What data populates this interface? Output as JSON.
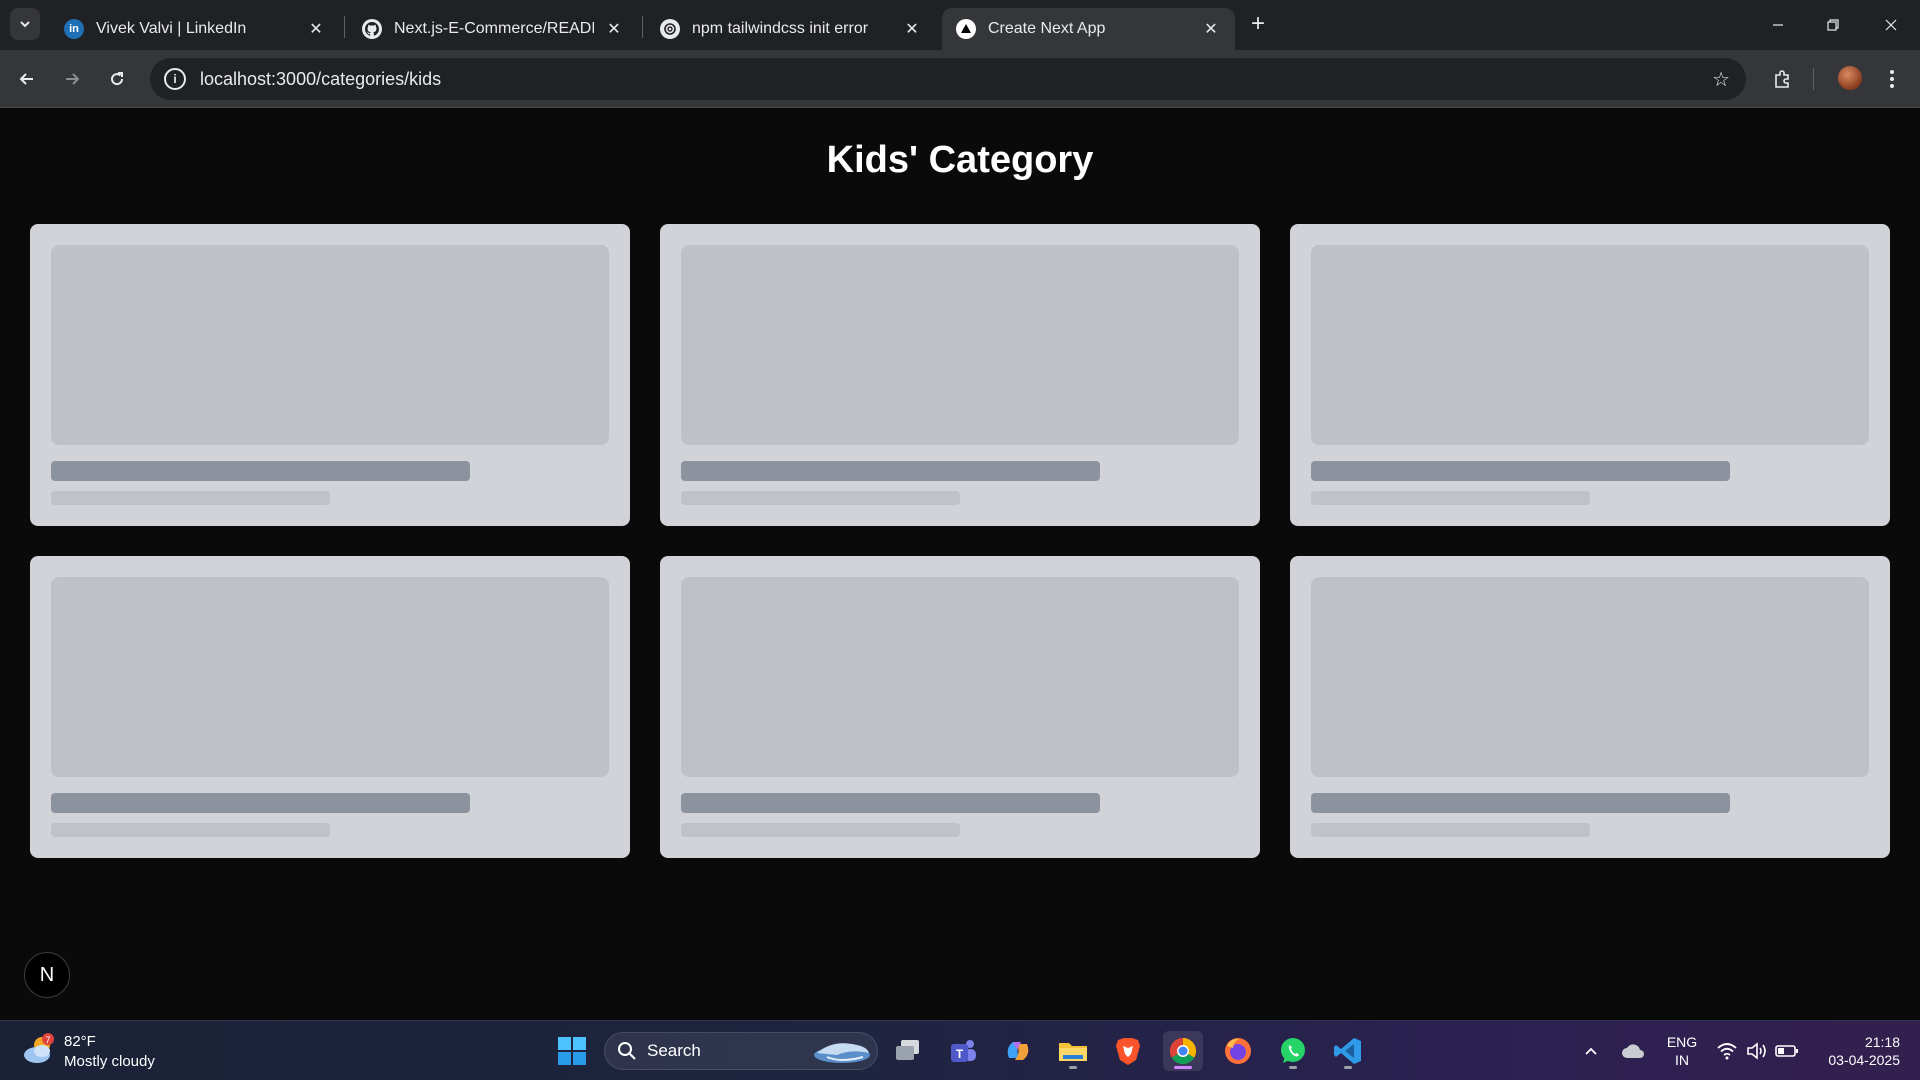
{
  "browser": {
    "tabs": [
      {
        "title": "Vivek Valvi | LinkedIn",
        "icon": "linkedin-icon",
        "active": false
      },
      {
        "title": "Next.js-E-Commerce/README.md",
        "icon": "github-icon",
        "active": false
      },
      {
        "title": "npm tailwindcss init error",
        "icon": "chatgpt-icon",
        "active": false
      },
      {
        "title": "Create Next App",
        "icon": "nextjs-icon",
        "active": true
      }
    ],
    "url": "localhost:3000/categories/kids"
  },
  "page": {
    "title": "Kids' Category",
    "cards_count_label": "",
    "next_badge": "N"
  },
  "taskbar": {
    "weather": {
      "temp": "82°F",
      "desc": "Mostly cloudy",
      "badge": "7"
    },
    "search_label": "Search",
    "lang_line1": "ENG",
    "lang_line2": "IN",
    "time": "21:18",
    "date": "03-04-2025"
  },
  "colors": {
    "page_bg": "#0a0a0a",
    "card_bg": "#d1d3d8",
    "skeleton_image": "#bfc1c8",
    "skeleton_title": "#8c939e",
    "skeleton_subtitle": "#c0c2c9"
  }
}
